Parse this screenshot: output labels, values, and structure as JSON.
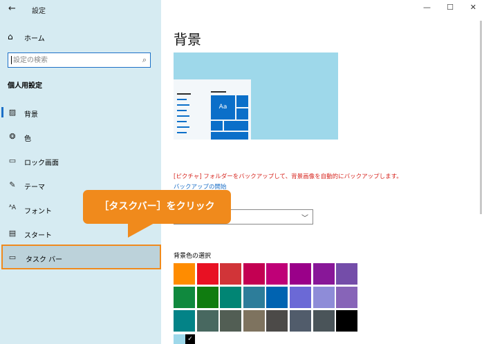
{
  "window": {
    "back_icon": "←",
    "title": "設定",
    "minimize": "—",
    "maximize": "☐",
    "close": "✕"
  },
  "sidebar": {
    "home": {
      "icon": "home-icon",
      "label": "ホーム"
    },
    "search": {
      "placeholder": "設定の検索"
    },
    "section_title": "個人用設定",
    "items": [
      {
        "icon": "picture-icon",
        "label": "背景",
        "selected": true
      },
      {
        "icon": "palette-icon",
        "label": "色"
      },
      {
        "icon": "lock-screen-icon",
        "label": "ロック画面"
      },
      {
        "icon": "theme-icon",
        "label": "テーマ"
      },
      {
        "icon": "font-icon",
        "label": "フォント"
      },
      {
        "icon": "start-icon",
        "label": "スタート"
      },
      {
        "icon": "taskbar-icon",
        "label": "タスク バー",
        "highlighted": true
      }
    ]
  },
  "main": {
    "title": "背景",
    "preview_tile_label": "Aa",
    "notice": "[ピクチャ] フォルダーをバックアップして、背景画像を自動的にバックアップします。",
    "backup_link": "バックアップの開始",
    "dropdown_value": "",
    "color_label": "背景色の選択",
    "swatches": [
      [
        "#ff8c00",
        "#e81123",
        "#d13438",
        "#c30052",
        "#bf0077",
        "#9a0089",
        "#881798",
        "#744da9"
      ],
      [
        "#10893e",
        "#107c10",
        "#018574",
        "#2d7d9a",
        "#0063b1",
        "#6b69d6",
        "#8e8cd8",
        "#8764b8"
      ],
      [
        "#038387",
        "#486860",
        "#525e54",
        "#7e735f",
        "#4c4a48",
        "#515c6b",
        "#4a5459",
        "#000000"
      ]
    ],
    "selected_color": "#9ed8ea"
  },
  "callout": {
    "text": "［タスクバー］をクリック",
    "color": "#f08a1c"
  }
}
